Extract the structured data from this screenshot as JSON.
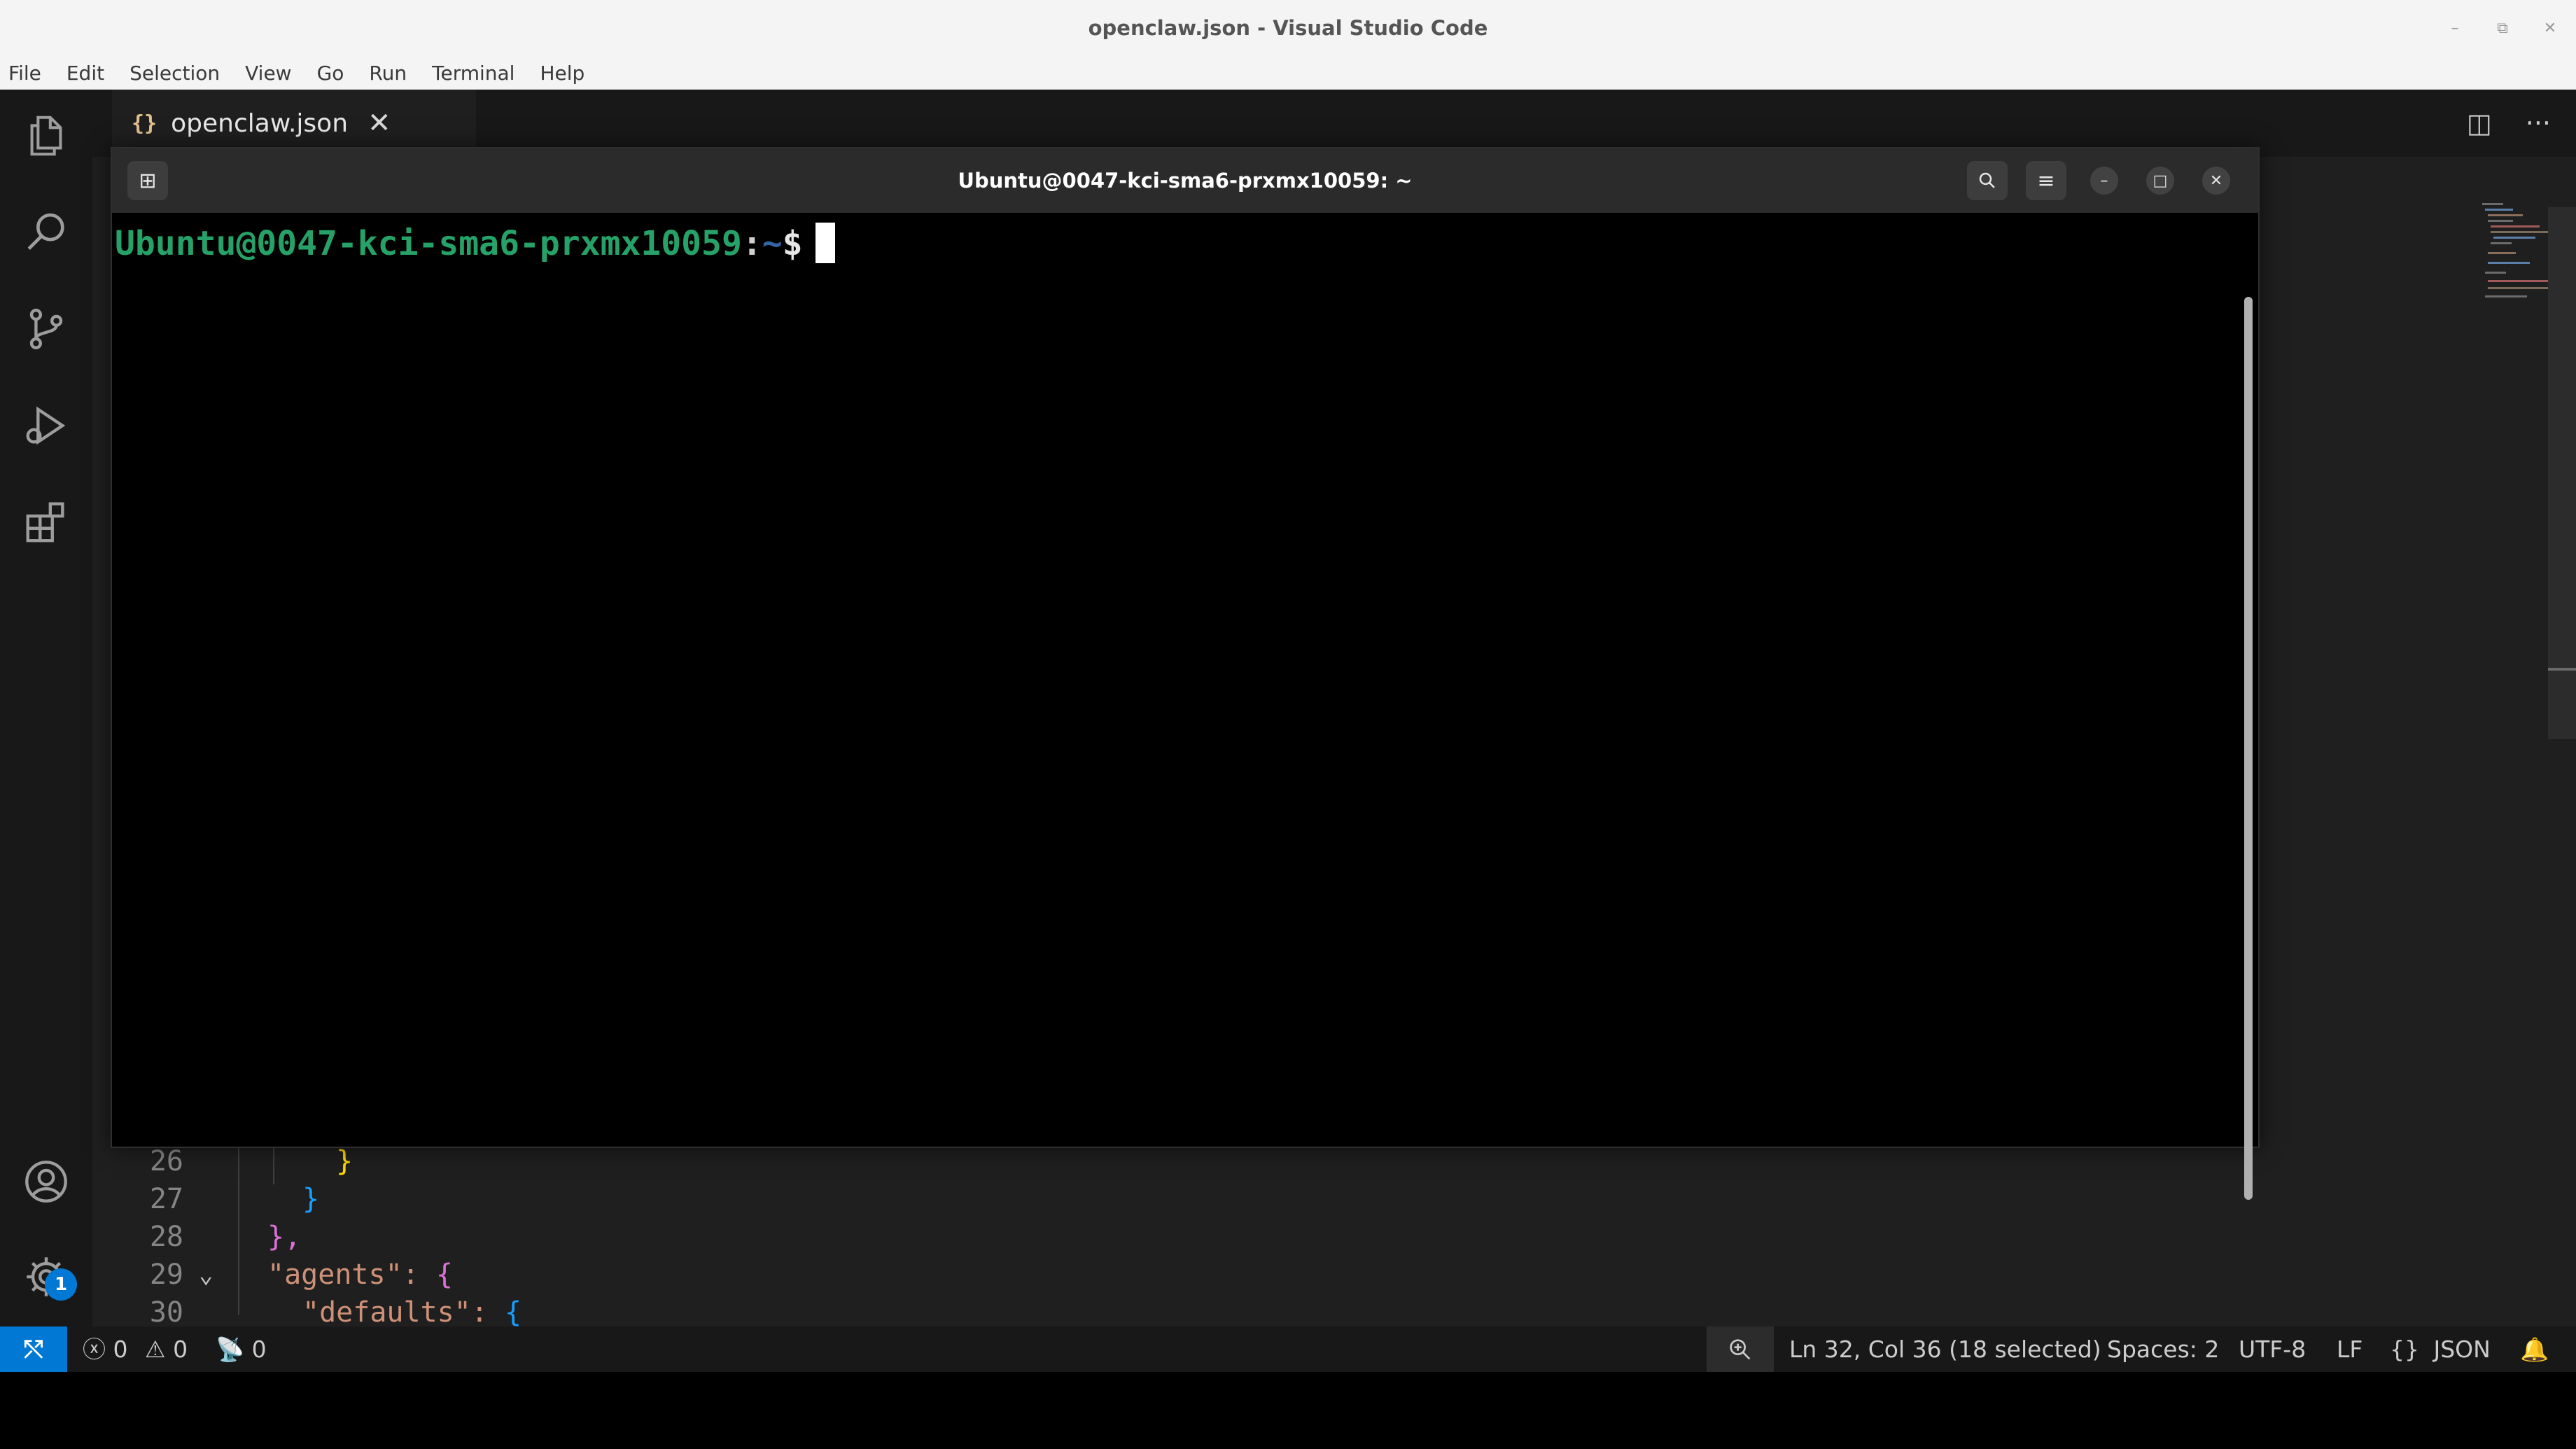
{
  "window": {
    "title": "openclaw.json - Visual Studio Code"
  },
  "menu": [
    "File",
    "Edit",
    "Selection",
    "View",
    "Go",
    "Run",
    "Terminal",
    "Help"
  ],
  "activity_icons": [
    "explorer-icon",
    "search-icon",
    "source-control-icon",
    "run-debug-icon",
    "extensions-icon",
    "account-icon",
    "manage-gear-icon"
  ],
  "manage_badge": "1",
  "tab": {
    "icon": "{}",
    "filename": "openclaw.json",
    "close": "✕"
  },
  "tab_actions": {
    "split": "◫",
    "more": "···"
  },
  "code_lines": [
    {
      "num": "26",
      "text": "}",
      "color": "#ffd700"
    },
    {
      "num": "27",
      "text": "}",
      "color": "#179fff"
    },
    {
      "num": "28",
      "text": "},",
      "color": "#da70d6"
    },
    {
      "num": "29",
      "text": "\"agents\": {",
      "color": "#ce9178"
    },
    {
      "num": "30",
      "text": "\"defaults\": {",
      "color": "#ce9178"
    }
  ],
  "terminal": {
    "title": "Ubuntu@0047-kci-sma6-prxmx10059: ~",
    "prompt_user": "Ubuntu@0047-kci-sma6-prxmx10059",
    "prompt_colon": ":",
    "prompt_path": "~",
    "prompt_dollar": "$"
  },
  "status": {
    "errors": "0",
    "warnings": "0",
    "ports": "0",
    "position": "Ln 32, Col 36 (18 selected)",
    "spaces": "Spaces: 2",
    "encoding": "UTF-8",
    "eol": "LF",
    "language_icon": "{}",
    "language": "JSON"
  },
  "colors": {
    "accent": "#0078d4",
    "terminal_user": "#26a269",
    "terminal_path": "#3465a4"
  }
}
